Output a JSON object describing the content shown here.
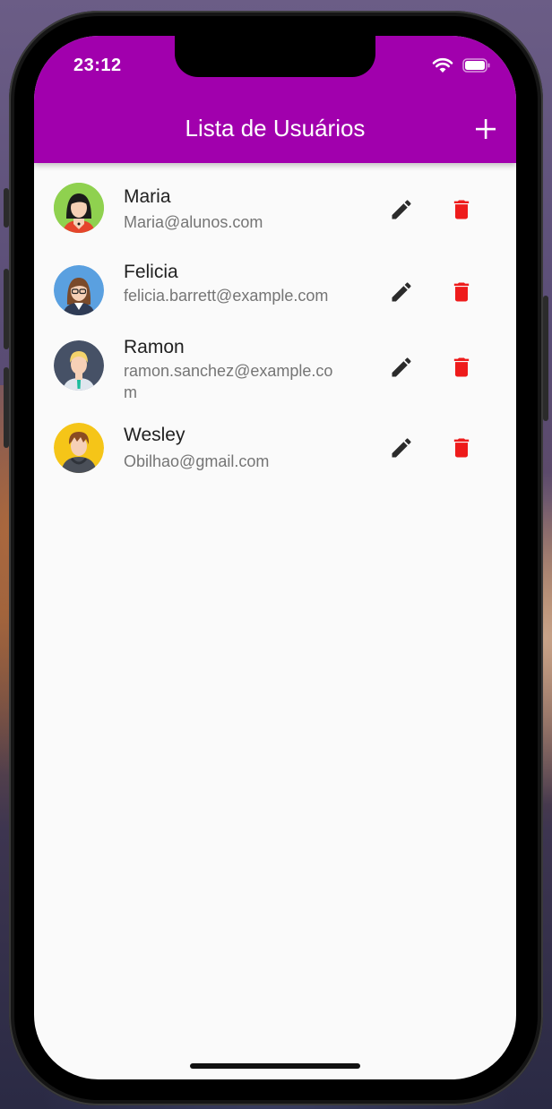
{
  "status_bar": {
    "time": "23:12"
  },
  "app_bar": {
    "title": "Lista de Usuários",
    "add_icon": "plus-icon"
  },
  "colors": {
    "app_bar": "#a100ad",
    "delete": "#ee1b1b",
    "edit": "#2b2b2b"
  },
  "users": [
    {
      "name": "Maria",
      "email": "Maria@alunos.com",
      "avatar": "avatar-woman-black-hair"
    },
    {
      "name": "Felicia",
      "email": "felicia.barrett@example.com",
      "avatar": "avatar-woman-glasses"
    },
    {
      "name": "Ramon",
      "email": "ramon.sanchez@example.com",
      "avatar": "avatar-man-blond"
    },
    {
      "name": "Wesley",
      "email": "Obilhao@gmail.com",
      "avatar": "avatar-man-hoodie"
    }
  ]
}
